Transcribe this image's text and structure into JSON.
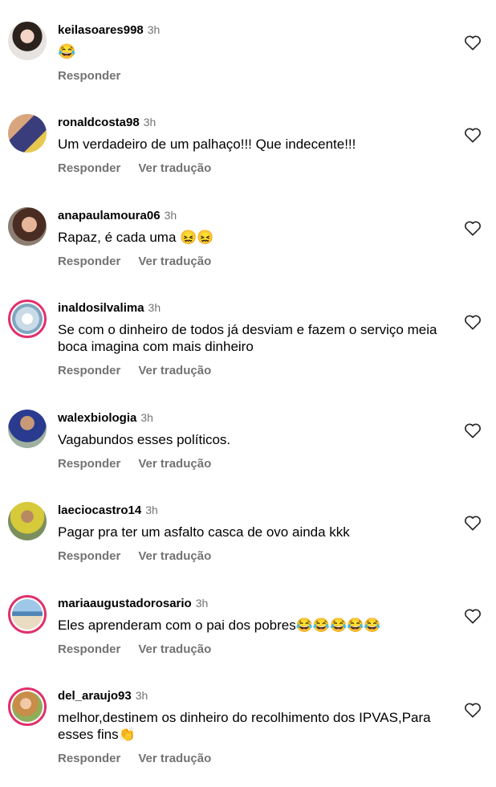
{
  "comments": [
    {
      "username": "keilasoares998",
      "time": "3h",
      "text": "😂",
      "reply": "Responder",
      "translate": ""
    },
    {
      "username": "ronaldcosta98",
      "time": "3h",
      "text": "Um verdadeiro de um palhaço!!! Que indecente!!!",
      "reply": "Responder",
      "translate": "Ver tradução"
    },
    {
      "username": "anapaulamoura06",
      "time": "3h",
      "text": "Rapaz, é cada uma 😖😖",
      "reply": "Responder",
      "translate": "Ver tradução"
    },
    {
      "username": "inaldosilvalima",
      "time": "3h",
      "text": "Se com o dinheiro de todos já desviam e fazem o serviço meia boca imagina com mais dinheiro",
      "reply": "Responder",
      "translate": "Ver tradução"
    },
    {
      "username": "walexbiologia",
      "time": "3h",
      "text": "Vagabundos esses políticos.",
      "reply": "Responder",
      "translate": "Ver tradução"
    },
    {
      "username": "laeciocastro14",
      "time": "3h",
      "text": "Pagar pra ter um asfalto casca de ovo ainda kkk",
      "reply": "Responder",
      "translate": "Ver tradução"
    },
    {
      "username": "mariaaugustadorosario",
      "time": "3h",
      "text": "Eles aprenderam com o pai dos pobres😂😂😂😂😂",
      "reply": "Responder",
      "translate": "Ver tradução"
    },
    {
      "username": "del_araujo93",
      "time": "3h",
      "text": "melhor,destinem os dinheiro do recolhimento dos IPVAS,Para esses fins👏",
      "reply": "Responder",
      "translate": "Ver tradução"
    }
  ],
  "colors": {
    "muted": "#737373",
    "story_ring": "#e1306c"
  }
}
